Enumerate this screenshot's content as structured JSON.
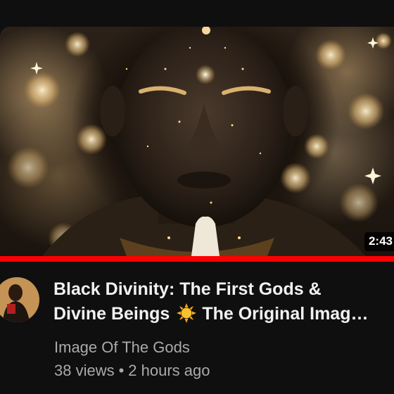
{
  "video": {
    "duration": "2:43",
    "watch_progress": 1.0,
    "title_line1": "Black Divinity: The First Gods &",
    "title_line2_start": "Divine Beings",
    "title_line2_end": "The Original Imag…",
    "title_icon": "sun-emoji-icon",
    "channel": "Image Of The Gods",
    "views": "38 views",
    "separator": "•",
    "age": "2 hours ago"
  },
  "colors": {
    "background": "#0f0f0f",
    "progress": "#ff0000",
    "title_text": "#f1f1f1",
    "meta_text": "#aaaaaa"
  }
}
